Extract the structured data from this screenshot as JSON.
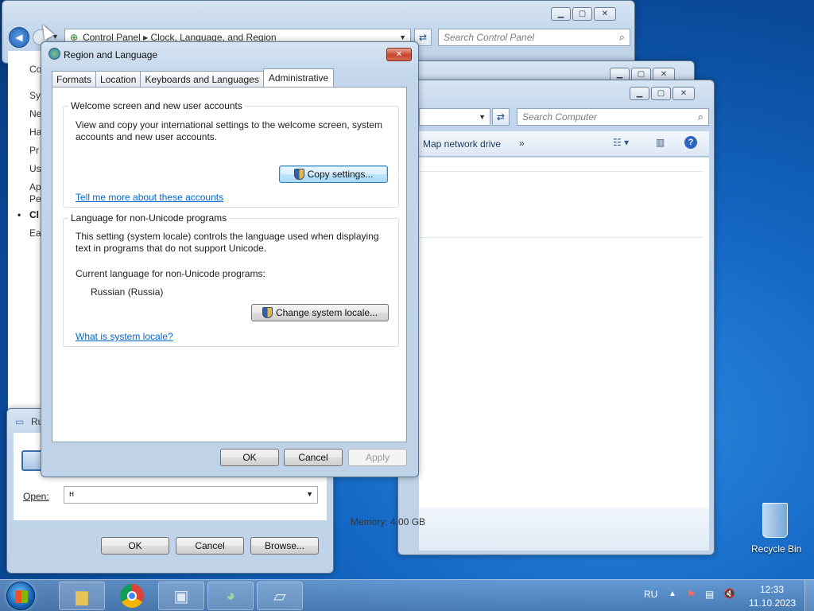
{
  "control_panel": {
    "address": "Control Panel  ▸  Clock, Language, and Region",
    "search_placeholder": "Search Control Panel",
    "sidebar_items": [
      "Co",
      "Sy",
      "Ne",
      "Ha",
      "Pr",
      "Us",
      "Ap Pe",
      "Cl",
      "Ea"
    ]
  },
  "explorer": {
    "search_placeholder": "Search Computer",
    "toolbar_map": "Map network drive",
    "toolbar_more": "»",
    "memory": "Memory: 4,00 GB"
  },
  "run": {
    "title": "Ru",
    "open_label": "Open:",
    "open_value": "н",
    "ok": "OK",
    "cancel": "Cancel",
    "browse": "Browse..."
  },
  "dialog": {
    "title": "Region and Language",
    "tabs": [
      "Formats",
      "Location",
      "Keyboards and Languages",
      "Administrative"
    ],
    "welcome": {
      "title": "Welcome screen and new user accounts",
      "desc_line1": "View and copy your international settings to the welcome screen, system",
      "desc_line2": "accounts and new user accounts.",
      "copy_button": "Copy settings...",
      "link": "Tell me more about these accounts"
    },
    "nonunicode": {
      "title": "Language for non-Unicode programs",
      "desc_line1": "This setting (system locale) controls the language used when displaying",
      "desc_line2": "text in programs that do not support Unicode.",
      "current_label": "Current language for non-Unicode programs:",
      "current_value": "Russian (Russia)",
      "change_button": "Change system locale...",
      "link": "What is system locale?"
    },
    "ok": "OK",
    "cancel": "Cancel",
    "apply": "Apply"
  },
  "desktop": {
    "recycle_bin": "Recycle Bin"
  },
  "taskbar": {
    "lang": "RU",
    "time": "12:33",
    "date": "11.10.2023"
  }
}
